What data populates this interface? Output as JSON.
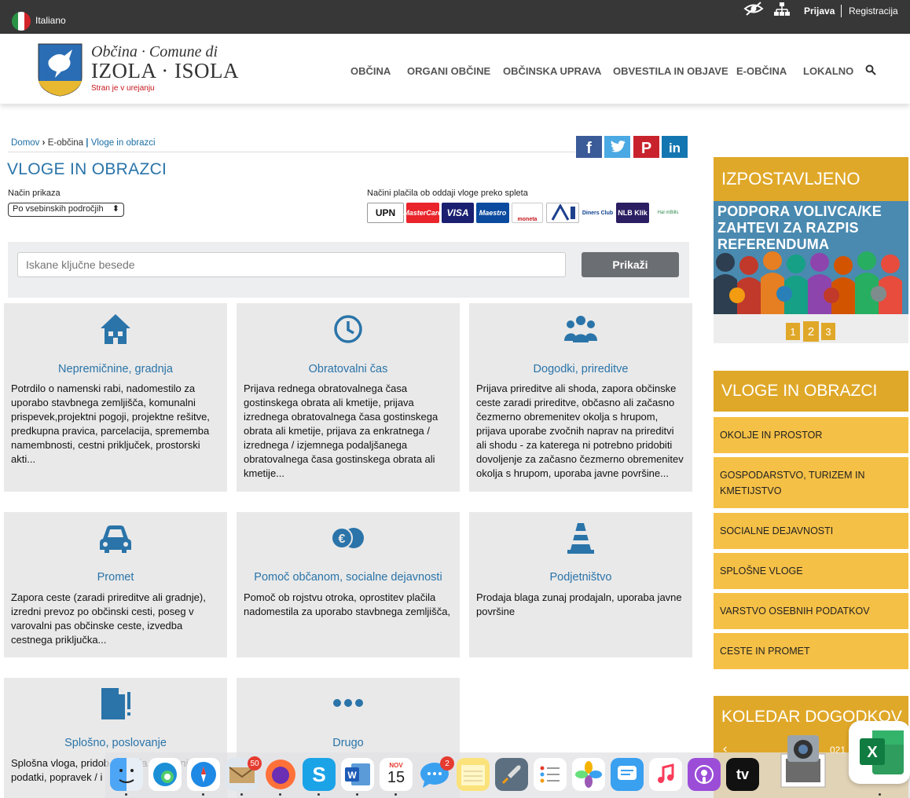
{
  "topbar": {
    "language": "Italiano",
    "login": "Prijava",
    "register": "Registracija"
  },
  "brand": {
    "line1": "Občina · Comune di",
    "line2": "IZOLA · ISOLA",
    "tagline": "Stran je v urejanju"
  },
  "nav": [
    "OBČINA",
    "ORGANI OBČINE",
    "OBČINSKA UPRAVA",
    "OBVESTILA IN OBJAVE",
    "E-OBČINA",
    "LOKALNO"
  ],
  "breadcrumb": {
    "home": "Domov",
    "section": "E-občina",
    "current": "Vloge in obrazci"
  },
  "page_title": "VLOGE IN OBRAZCI",
  "view": {
    "label": "Način prikaza",
    "selected": "Po vsebinskih področjih"
  },
  "payment": {
    "label": "Načini plačila ob oddaji vloge preko spleta",
    "methods": [
      "UPN",
      "MasterCard",
      "VISA",
      "Maestro",
      "moneta",
      "",
      "",
      "Diners Club",
      "NLB Klik",
      "Hal mBills"
    ]
  },
  "search": {
    "placeholder": "Iskane ključne besede",
    "button": "Prikaži"
  },
  "cards": [
    {
      "title": "Nepremičnine, gradnja",
      "icon": "house-icon",
      "text": "Potrdilo o namenski rabi, nadomestilo za uporabo stavbnega zemljišča, komunalni prispevek,projektni pogoji, projektne rešitve, predkupna pravica, parcelacija, sprememba namembnosti, cestni priključek, prostorski akti..."
    },
    {
      "title": "Obratovalni čas",
      "icon": "clock-icon",
      "text": "Prijava rednega obratovalnega časa gostinskega obrata ali kmetije, prijava izrednega obratovalnega časa gostinskega obrata ali kmetije, prijava za enkratnega / izrednega / izjemnega podaljšanega obratovalnega časa gostinskega obrata ali kmetije..."
    },
    {
      "title": "Dogodki, prireditve",
      "icon": "people-icon",
      "text": "Prijava prireditve ali shoda, zapora občinske ceste zaradi prireditve, občasno ali začasno čezmerno obremenitev okolja s hrupom, prijava uporabe zvočnih naprav na prireditvi ali shodu - za katerega ni potrebno pridobiti dovoljenje za začasno čezmerno obremenitev okolja s hrupom, uporaba javne površine..."
    },
    {
      "title": "Promet",
      "icon": "car-icon",
      "text": "Zapora ceste (zaradi prireditve ali gradnje), izredni prevoz po občinski cesti, poseg v varovalni pas občinske ceste, izvedba cestnega priključka..."
    },
    {
      "title": "Pomoč občanom, socialne dejavnosti",
      "icon": "euro-coins-icon",
      "text": "Pomoč ob rojstvu otroka, oprostitev plačila nadomestila za uporabo stavbnega zemljišča,"
    },
    {
      "title": "Podjetništvo",
      "icon": "traffic-cone-icon",
      "text": "Prodaja blaga zunaj prodajaln, uporaba javne površine"
    },
    {
      "title": "Splošno, poslovanje",
      "icon": "document-icon",
      "text": "Splošna vloga, pridob značaja, seznanitev z podatki, popravek / i"
    },
    {
      "title": "Drugo",
      "icon": "more-dots-icon",
      "text": ""
    }
  ],
  "featured": {
    "title": "IZPOSTAVLJENO",
    "banner": "PODPORA VOLIVCA/KE ZAHTEVI ZA RAZPIS REFERENDUMA",
    "pages": [
      "1",
      "2",
      "3"
    ]
  },
  "forms": {
    "title": "VLOGE IN OBRAZCI",
    "items": [
      "OKOLJE IN PROSTOR",
      "GOSPODARSTVO, TURIZEM IN KMETIJSTVO",
      "SOCIALNE DEJAVNOSTI",
      "SPLOŠNE VLOGE",
      "VARSTVO OSEBNIH PODATKOV",
      "CESTE IN PROMET"
    ]
  },
  "calendar": {
    "title": "KOLEDAR DOGODKOV",
    "date_fragment": "021"
  },
  "dock": {
    "mail_badge": "50",
    "messages_badge": "2",
    "calendar_month": "NOV",
    "calendar_day": "15",
    "tv_label": "tv"
  },
  "colors": {
    "accent": "#e0a829",
    "link": "#2a74a9",
    "topbar": "#373737",
    "card": "#e9e9e9"
  }
}
